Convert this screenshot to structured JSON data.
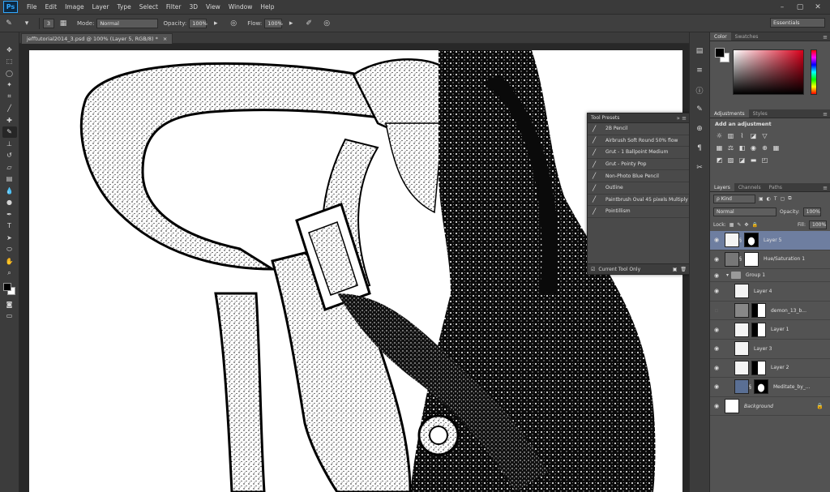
{
  "app": {
    "logo": "Ps"
  },
  "menu": [
    "File",
    "Edit",
    "Image",
    "Layer",
    "Type",
    "Select",
    "Filter",
    "3D",
    "View",
    "Window",
    "Help"
  ],
  "window_controls": [
    "–",
    "▢",
    "✕"
  ],
  "options_bar": {
    "brush_size": "3",
    "mode_label": "Mode:",
    "mode_value": "Normal",
    "opacity_label": "Opacity:",
    "opacity_value": "100%",
    "flow_label": "Flow:",
    "flow_value": "100%",
    "workspace": "Essentials"
  },
  "document_tab": {
    "title": "jefftutorial2014_3.psd @ 100% (Layer 5, RGB/8) *",
    "close": "×"
  },
  "tool_presets": {
    "title": "Tool Presets",
    "items": [
      "2B Pencil",
      "Airbrush Soft Round 50% flow",
      "Grut - 1 Ballpoint Medium",
      "Grut - Pointy Pop",
      "Non-Photo Blue Pencil",
      "Outline",
      "Paintbrush Oval 45 pixels Multiply",
      "Pointillism"
    ],
    "current_tool_only": "Current Tool Only"
  },
  "color_panel": {
    "tabs": [
      "Color",
      "Swatches"
    ]
  },
  "adjustments_panel": {
    "tabs": [
      "Adjustments",
      "Styles"
    ],
    "title": "Add an adjustment"
  },
  "layers_panel": {
    "tabs": [
      "Layers",
      "Channels",
      "Paths"
    ],
    "filter_kind": "ρ Kind",
    "blend_mode": "Normal",
    "opacity_label": "Opacity:",
    "opacity_value": "100%",
    "lock_label": "Lock:",
    "fill_label": "Fill:",
    "fill_value": "100%",
    "layers": [
      {
        "name": "Layer 5",
        "selected": true
      },
      {
        "name": "Hue/Saturation 1"
      },
      {
        "name": "Group 1"
      },
      {
        "name": "Layer 4"
      },
      {
        "name": "demon_13_b..."
      },
      {
        "name": "Layer 1"
      },
      {
        "name": "Layer 3"
      },
      {
        "name": "Layer 2"
      },
      {
        "name": "Meditate_by_..."
      },
      {
        "name": "Background"
      }
    ]
  },
  "colors": {
    "foreground": "#000000",
    "background": "#ffffff",
    "selected_layer": "#6e7ea0",
    "accent": "#31a8ff"
  }
}
